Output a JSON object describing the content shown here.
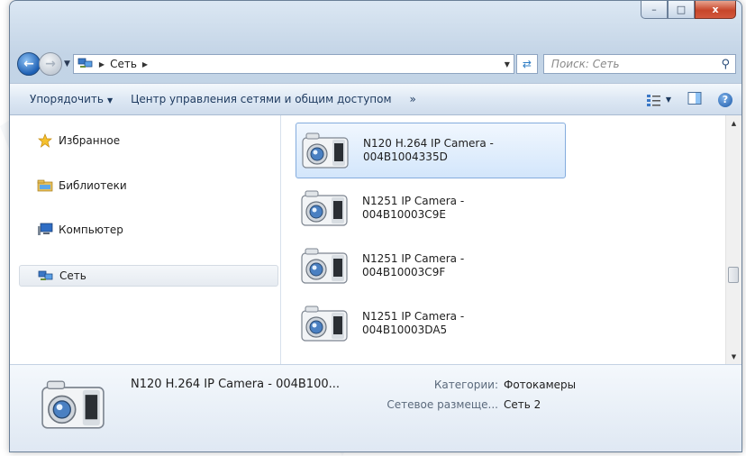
{
  "window": {
    "caption_buttons": {
      "minimize": "–",
      "maximize": "□",
      "close": "x"
    }
  },
  "address_bar": {
    "breadcrumb": [
      "Сеть"
    ],
    "search_placeholder": "Поиск: Сеть"
  },
  "toolbar": {
    "organize": "Упорядочить",
    "network_center": "Центр управления сетями и общим доступом",
    "more": "»"
  },
  "nav_pane": {
    "items": [
      {
        "label": "Избранное",
        "icon": "star-icon"
      },
      {
        "label": "Библиотеки",
        "icon": "library-icon"
      },
      {
        "label": "Компьютер",
        "icon": "computer-icon"
      },
      {
        "label": "Сеть",
        "icon": "network-icon",
        "selected": true
      }
    ]
  },
  "files": [
    {
      "name": "N120 H.264 IP Camera - 004B1004335D",
      "selected": true
    },
    {
      "name": "N1251 IP Camera - 004B10003C9E"
    },
    {
      "name": "N1251 IP Camera - 004B10003C9F"
    },
    {
      "name": "N1251 IP Camera - 004B10003DA5"
    }
  ],
  "details": {
    "name": "N120 H.264 IP Camera - 004B100...",
    "category_label": "Категории:",
    "category_value": "Фотокамеры",
    "location_label": "Сетевое размеще...",
    "location_value": "Сеть 2"
  },
  "colors": {
    "accent": "#2d7cc4",
    "selection_fill": "#d3e6fb",
    "selection_border": "#84acdd",
    "close_button": "#c7452a"
  }
}
